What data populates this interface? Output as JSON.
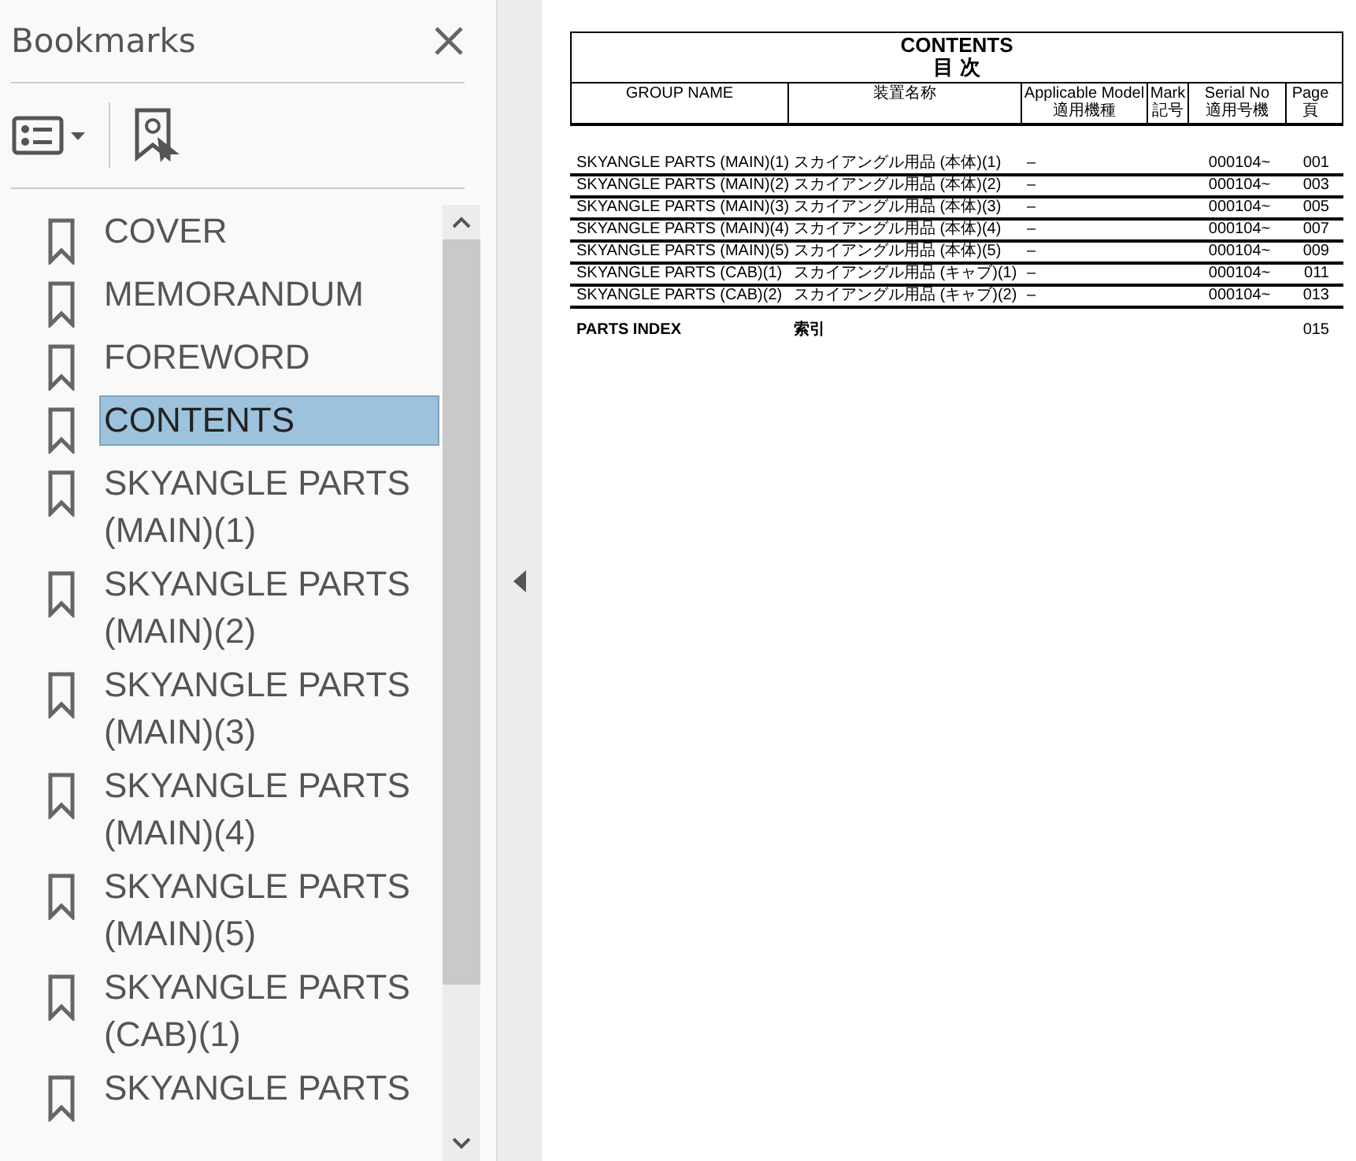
{
  "panel": {
    "title": "Bookmarks"
  },
  "bookmarks": [
    {
      "label": "COVER",
      "selected": false
    },
    {
      "label": "MEMORANDUM",
      "selected": false
    },
    {
      "label": "FOREWORD",
      "selected": false
    },
    {
      "label": "CONTENTS",
      "selected": true
    },
    {
      "label": "SKYANGLE PARTS (MAIN)(1)",
      "selected": false
    },
    {
      "label": "SKYANGLE PARTS (MAIN)(2)",
      "selected": false
    },
    {
      "label": "SKYANGLE PARTS (MAIN)(3)",
      "selected": false
    },
    {
      "label": "SKYANGLE PARTS (MAIN)(4)",
      "selected": false
    },
    {
      "label": "SKYANGLE PARTS (MAIN)(5)",
      "selected": false
    },
    {
      "label": "SKYANGLE PARTS (CAB)(1)",
      "selected": false
    },
    {
      "label": "SKYANGLE PARTS",
      "selected": false
    }
  ],
  "document": {
    "title": "CONTENTS",
    "subtitle": "目 次",
    "columns": [
      {
        "label": "GROUP NAME"
      },
      {
        "label": "装置名称"
      },
      {
        "label": "Applicable Model",
        "label_jp": "適用機種"
      },
      {
        "label": "Mark",
        "label_jp": "記号"
      },
      {
        "label": "Serial No",
        "label_jp": "適用号機"
      },
      {
        "label": "Page",
        "label_jp": "頁"
      }
    ],
    "rows": [
      [
        "SKYANGLE PARTS (MAIN)(1)",
        "スカイアングル用品 (本体)(1)",
        "–",
        "",
        "000104~",
        "001"
      ],
      [
        "SKYANGLE PARTS (MAIN)(2)",
        "スカイアングル用品 (本体)(2)",
        "–",
        "",
        "000104~",
        "003"
      ],
      [
        "SKYANGLE PARTS (MAIN)(3)",
        "スカイアングル用品 (本体)(3)",
        "–",
        "",
        "000104~",
        "005"
      ],
      [
        "SKYANGLE PARTS (MAIN)(4)",
        "スカイアングル用品 (本体)(4)",
        "–",
        "",
        "000104~",
        "007"
      ],
      [
        "SKYANGLE PARTS (MAIN)(5)",
        "スカイアングル用品 (本体)(5)",
        "–",
        "",
        "000104~",
        "009"
      ],
      [
        "SKYANGLE PARTS (CAB)(1)",
        "スカイアングル用品 (キャブ)(1)",
        "–",
        "",
        "000104~",
        "011"
      ],
      [
        "SKYANGLE PARTS (CAB)(2)",
        "スカイアングル用品 (キャブ)(2)",
        "–",
        "",
        "000104~",
        "013"
      ]
    ],
    "index": {
      "name": "PARTS INDEX",
      "name_jp": "索引",
      "page": "015"
    }
  }
}
